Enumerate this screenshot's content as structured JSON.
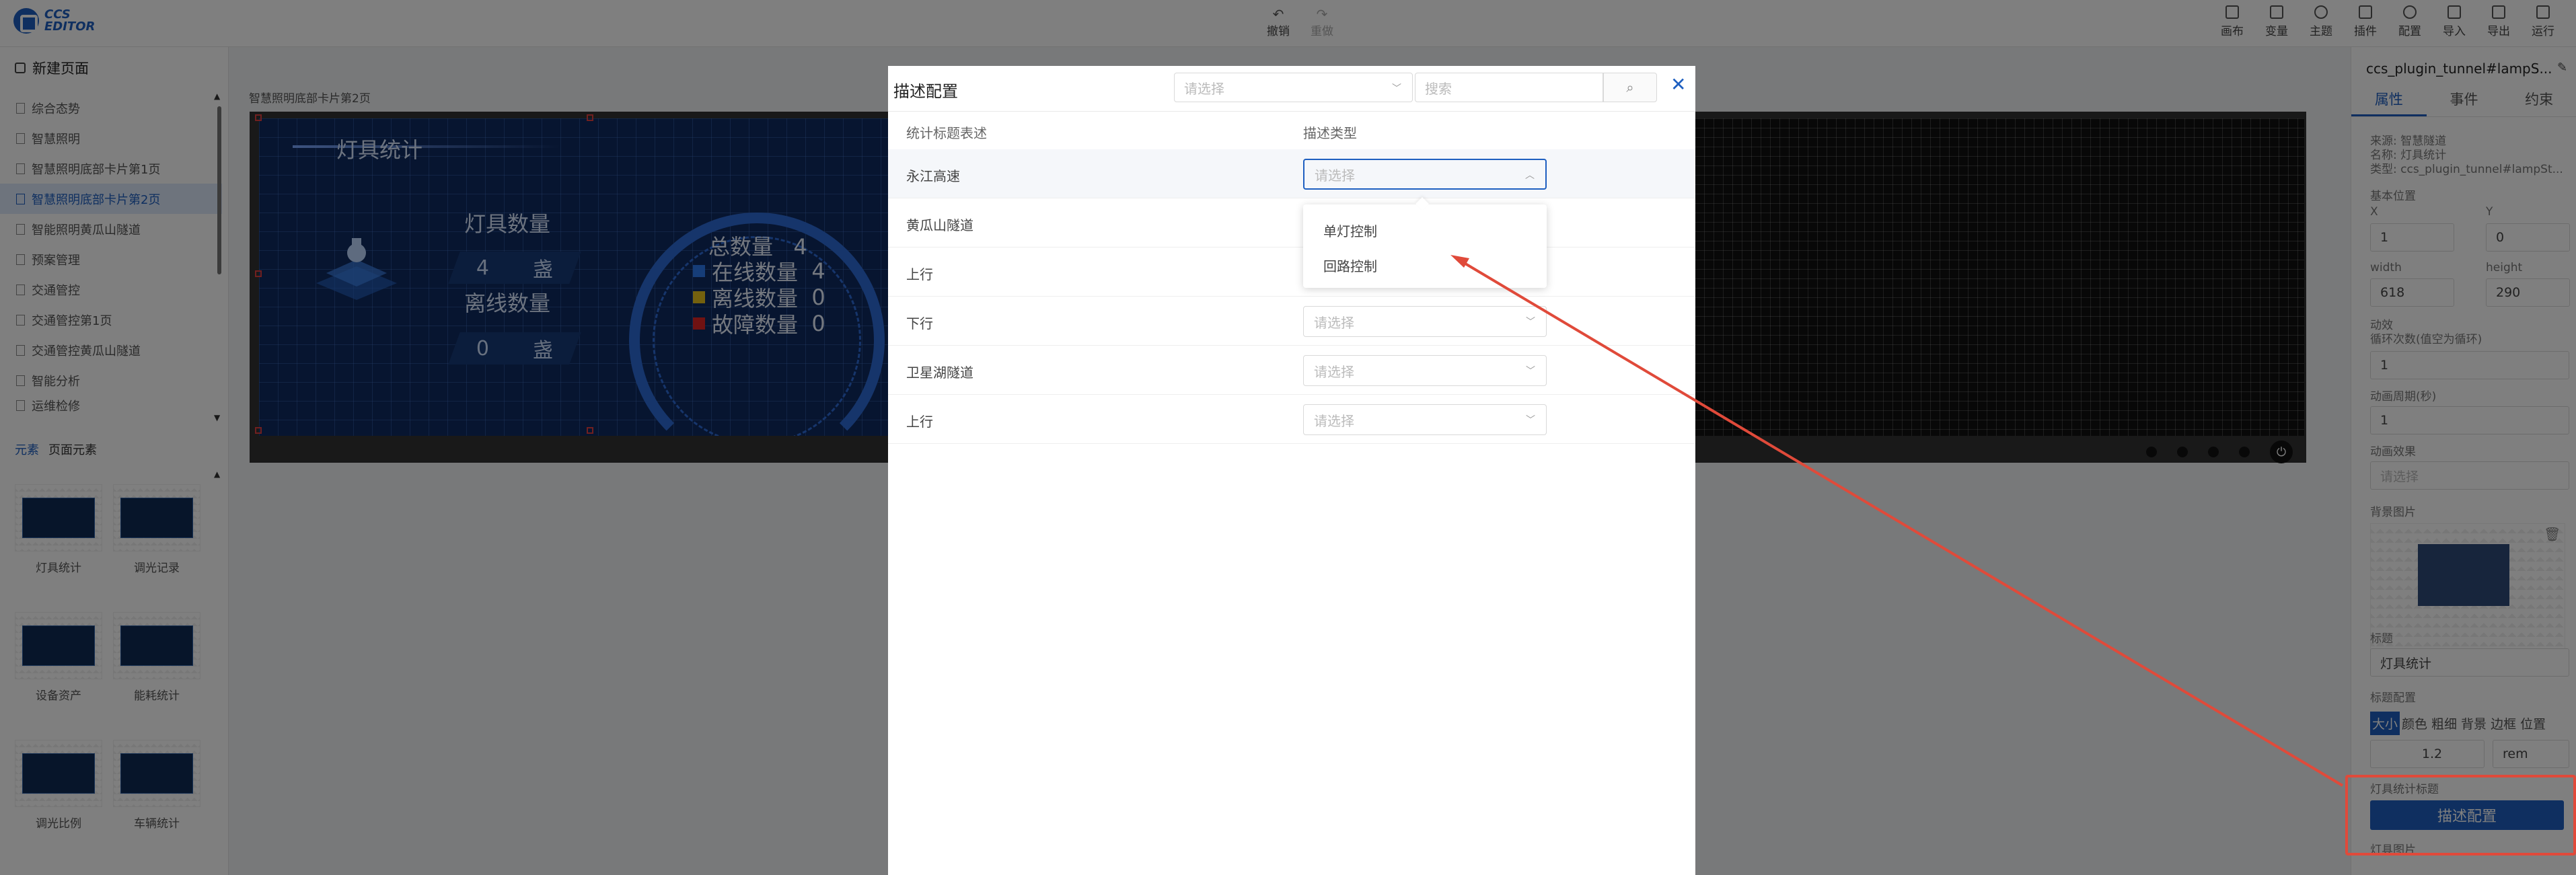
{
  "app": {
    "logo_text": "CCS EDITOR"
  },
  "toolbar": {
    "undo": "撤销",
    "redo": "重做",
    "right_items": [
      {
        "label": "画布",
        "icon": "canvas-icon"
      },
      {
        "label": "变量",
        "icon": "variable-icon"
      },
      {
        "label": "主题",
        "icon": "theme-icon"
      },
      {
        "label": "插件",
        "icon": "plugin-icon"
      },
      {
        "label": "配置",
        "icon": "config-icon"
      },
      {
        "label": "导入",
        "icon": "import-icon"
      },
      {
        "label": "导出",
        "icon": "export-icon"
      },
      {
        "label": "运行",
        "icon": "run-icon"
      }
    ]
  },
  "left_panel": {
    "new_page": "新建页面",
    "pages": [
      "综合态势",
      "智慧照明",
      "智慧照明底部卡片第1页",
      "智慧照明底部卡片第2页",
      "智能照明黄瓜山隧道",
      "预案管理",
      "交通管控",
      "交通管控第1页",
      "交通管控黄瓜山隧道",
      "智能分析",
      "运维检修"
    ],
    "active_page": 3,
    "tabs": [
      "元素",
      "页面元素"
    ],
    "elements": [
      "灯具统计",
      "调光记录",
      "设备资产",
      "能耗统计",
      "调光比例",
      "车辆统计"
    ]
  },
  "canvas": {
    "page_label": "智慧照明底部卡片第2页",
    "widget": {
      "title": "灯具统计",
      "lamp_count_label": "灯具数量",
      "lamp_count": "4",
      "unit": "盏",
      "offline_label": "离线数量",
      "offline_count": "0",
      "total_label": "总数量",
      "total": "4",
      "legend": [
        {
          "label": "在线数量",
          "value": "4",
          "color": "#2d7bf0"
        },
        {
          "label": "离线数量",
          "value": "0",
          "color": "#e8c21c"
        },
        {
          "label": "故障数量",
          "value": "0",
          "color": "#e02424"
        }
      ]
    }
  },
  "right_panel": {
    "title": "ccs_plugin_tunnel#lampS...",
    "tabs": [
      "属性",
      "事件",
      "约束"
    ],
    "source": "来源: 智慧隧道",
    "name": "名称: 灯具统计",
    "type": "类型: ccs_plugin_tunnel#lampSt...",
    "base_pos": "基本位置",
    "x_label": "X",
    "x_value": "1",
    "y_label": "Y",
    "y_value": "0",
    "w_label": "width",
    "w_value": "618",
    "h_label": "height",
    "h_value": "290",
    "anim": "动效",
    "loop_label": "循环次数(值空为循环)",
    "loop_value": "1",
    "period_label": "动画周期(秒)",
    "period_value": "1",
    "effect_label": "动画效果",
    "effect_placeholder": "请选择",
    "bgimg_label": "背景图片",
    "title_label": "标题",
    "title_value": "灯具统计",
    "title_config": "标题配置",
    "style_tabs": [
      "大小",
      "颜色",
      "粗细",
      "背景",
      "边框",
      "位置"
    ],
    "size_value": "1.2",
    "size_unit": "rem",
    "lamp_stat_title": "灯具统计标题",
    "desc_button": "描述配置",
    "lamp_img": "灯具图片"
  },
  "modal": {
    "title": "描述配置",
    "select_placeholder": "请选择",
    "search_placeholder": "搜索",
    "col1": "统计标题表述",
    "col2": "描述类型",
    "rows": [
      {
        "name": "永江高速",
        "placeholder": "请选择"
      },
      {
        "name": "黄瓜山隧道",
        "placeholder": "请选择"
      },
      {
        "name": "上行",
        "placeholder": "请选择"
      },
      {
        "name": "下行",
        "placeholder": "请选择"
      },
      {
        "name": "卫星湖隧道",
        "placeholder": "请选择"
      },
      {
        "name": "上行",
        "placeholder": "请选择"
      }
    ],
    "dropdown": [
      "单灯控制",
      "回路控制"
    ]
  }
}
